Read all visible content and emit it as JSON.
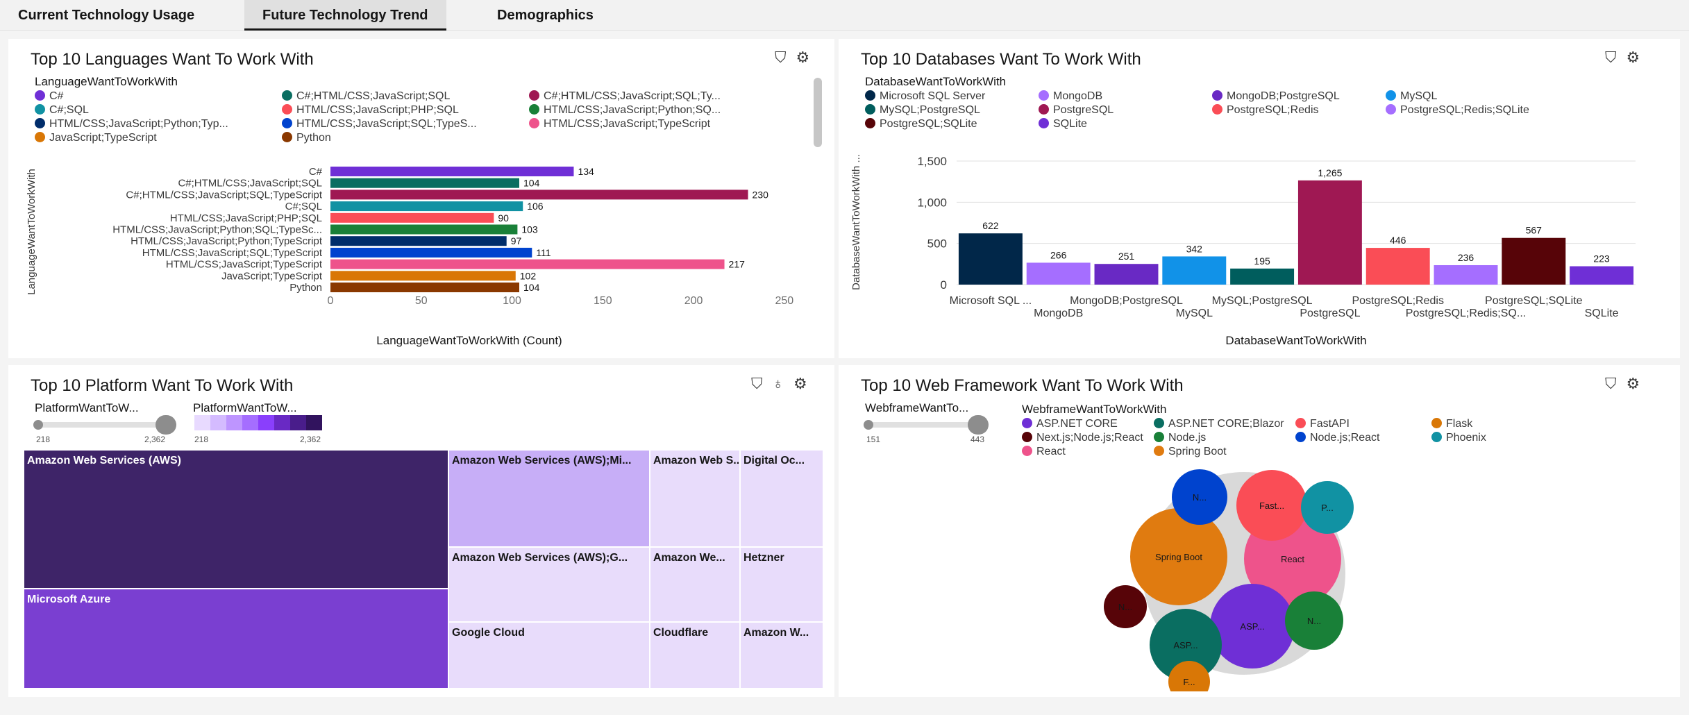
{
  "tabs": [
    {
      "label": "Current Technology Usage",
      "active": false
    },
    {
      "label": "Future Technology Trend",
      "active": true
    },
    {
      "label": "Demographics",
      "active": false
    }
  ],
  "lang": {
    "title": "Top 10 Languages Want To Work With",
    "legend_title": "LanguageWantToWorkWith",
    "legend": [
      {
        "label": "C#",
        "color": "#6f2fd6"
      },
      {
        "label": "C#;HTML/CSS;JavaScript;SQL",
        "color": "#0a6e61"
      },
      {
        "label": "C#;HTML/CSS;JavaScript;SQL;Ty...",
        "color": "#9f1853"
      },
      {
        "label": "C#;SQL",
        "color": "#1192a3"
      },
      {
        "label": "HTML/CSS;JavaScript;PHP;SQL",
        "color": "#fa4d56"
      },
      {
        "label": "HTML/CSS;JavaScript;Python;SQ...",
        "color": "#198038"
      },
      {
        "label": "HTML/CSS;JavaScript;Python;Typ...",
        "color": "#002d6b"
      },
      {
        "label": "HTML/CSS;JavaScript;SQL;TypeS...",
        "color": "#0043ce"
      },
      {
        "label": "HTML/CSS;JavaScript;TypeScript",
        "color": "#ee538b"
      },
      {
        "label": "JavaScript;TypeScript",
        "color": "#d97706"
      },
      {
        "label": "Python",
        "color": "#8a3800"
      }
    ],
    "ylabel": "LanguageWantToWorkWith",
    "xlabel": "LanguageWantToWorkWith (Count)"
  },
  "db": {
    "title": "Top 10 Databases Want To Work With",
    "legend_title": "DatabaseWantToWorkWith",
    "legend": [
      {
        "label": "Microsoft SQL Server",
        "color": "#012749"
      },
      {
        "label": "MongoDB",
        "color": "#a56eff"
      },
      {
        "label": "MongoDB;PostgreSQL",
        "color": "#6929c4"
      },
      {
        "label": "MySQL",
        "color": "#1192e8"
      },
      {
        "label": "MySQL;PostgreSQL",
        "color": "#005d5d"
      },
      {
        "label": "PostgreSQL",
        "color": "#9f1853"
      },
      {
        "label": "PostgreSQL;Redis",
        "color": "#fa4d56"
      },
      {
        "label": "PostgreSQL;Redis;SQLite",
        "color": "#a56eff"
      },
      {
        "label": "PostgreSQL;SQLite",
        "color": "#570408"
      },
      {
        "label": "SQLite",
        "color": "#6f2fd6"
      }
    ],
    "ylabel": "DatabaseWantToWorkWith ...",
    "xlabel": "DatabaseWantToWorkWith"
  },
  "platform": {
    "title": "Top 10 Platform Want To Work With",
    "slider1_title": "PlatformWantToW...",
    "slider2_title": "PlatformWantToW...",
    "min": "218",
    "max": "2,362",
    "scale_colors": [
      "#e8daff",
      "#d4bbff",
      "#be95ff",
      "#a56eff",
      "#8a3ffc",
      "#6929c4",
      "#491d8b",
      "#31135e"
    ],
    "cells": [
      {
        "label": "Amazon Web Services (AWS)",
        "bg": "#3e2468",
        "fg": "#ffffff"
      },
      {
        "label": "Microsoft Azure",
        "bg": "#7a3fd1",
        "fg": "#ffffff"
      },
      {
        "label": "Amazon Web Services (AWS);Mi...",
        "bg": "#c7aef7",
        "fg": "#161616"
      },
      {
        "label": "Amazon Web Services (AWS);G...",
        "bg": "#e8dcfb",
        "fg": "#161616"
      },
      {
        "label": "Google Cloud",
        "bg": "#e8dcfb",
        "fg": "#161616"
      },
      {
        "label": "Amazon Web S...",
        "bg": "#e8dcfb",
        "fg": "#161616"
      },
      {
        "label": "Digital Oc...",
        "bg": "#e8dcfb",
        "fg": "#161616"
      },
      {
        "label": "Amazon We...",
        "bg": "#e8dcfb",
        "fg": "#161616"
      },
      {
        "label": "Hetzner",
        "bg": "#e8dcfb",
        "fg": "#161616"
      },
      {
        "label": "Cloudflare",
        "bg": "#e8dcfb",
        "fg": "#161616"
      },
      {
        "label": "Amazon W...",
        "bg": "#e8dcfb",
        "fg": "#161616"
      }
    ]
  },
  "web": {
    "title": "Top 10 Web Framework Want To Work With",
    "slider_title": "WebframeWantTo...",
    "min": "151",
    "max": "443",
    "legend_title": "WebframeWantToWorkWith",
    "legend": [
      {
        "label": "ASP.NET CORE",
        "color": "#6f2fd6"
      },
      {
        "label": "ASP.NET CORE;Blazor",
        "color": "#0a6e61"
      },
      {
        "label": "FastAPI",
        "color": "#fa4d56"
      },
      {
        "label": "Flask",
        "color": "#d97706"
      },
      {
        "label": "Next.js;Node.js;React",
        "color": "#570408"
      },
      {
        "label": "Node.js",
        "color": "#198038"
      },
      {
        "label": "Node.js;React",
        "color": "#0043ce"
      },
      {
        "label": "Phoenix",
        "color": "#1192a3"
      },
      {
        "label": "React",
        "color": "#ee538b"
      },
      {
        "label": "Spring Boot",
        "color": "#e07b10"
      }
    ],
    "bubbles": [
      {
        "label": "Spring Boot",
        "color": "#e07b10"
      },
      {
        "label": "React",
        "color": "#ee538b"
      },
      {
        "label": "Fast...",
        "color": "#fa4d56"
      },
      {
        "label": "N...",
        "color": "#0043ce"
      },
      {
        "label": "P...",
        "color": "#1192a3"
      },
      {
        "label": "ASP...",
        "color": "#6f2fd6"
      },
      {
        "label": "ASP...",
        "color": "#0a6e61"
      },
      {
        "label": "N...",
        "color": "#198038"
      },
      {
        "label": "N...",
        "color": "#570408"
      },
      {
        "label": "F...",
        "color": "#d97706"
      }
    ]
  },
  "chart_data": [
    {
      "type": "bar",
      "orientation": "horizontal",
      "title": "Top 10 Languages Want To Work With",
      "xlabel": "LanguageWantToWorkWith (Count)",
      "ylabel": "LanguageWantToWorkWith",
      "categories": [
        "C#",
        "C#;HTML/CSS;JavaScript;SQL",
        "C#;HTML/CSS;JavaScript;SQL;TypeScript",
        "C#;SQL",
        "HTML/CSS;JavaScript;PHP;SQL",
        "HTML/CSS;JavaScript;Python;SQL;TypeSc...",
        "HTML/CSS;JavaScript;Python;TypeScript",
        "HTML/CSS;JavaScript;SQL;TypeScript",
        "HTML/CSS;JavaScript;TypeScript",
        "JavaScript;TypeScript",
        "Python"
      ],
      "values": [
        134,
        104,
        230,
        106,
        90,
        103,
        97,
        111,
        217,
        102,
        104
      ],
      "colors": [
        "#6f2fd6",
        "#0a6e61",
        "#9f1853",
        "#1192a3",
        "#fa4d56",
        "#198038",
        "#002d6b",
        "#0043ce",
        "#ee538b",
        "#d97706",
        "#8a3800"
      ],
      "xticks": [
        "0",
        "50",
        "100",
        "150",
        "200",
        "250"
      ],
      "xlim": [
        0,
        260
      ]
    },
    {
      "type": "bar",
      "title": "Top 10 Databases Want To Work With",
      "xlabel": "DatabaseWantToWorkWith",
      "ylabel": "DatabaseWantToWorkWith ...",
      "categories": [
        "Microsoft SQL ...",
        "MongoDB",
        "MongoDB;PostgreSQL",
        "MySQL",
        "MySQL;PostgreSQL",
        "PostgreSQL",
        "PostgreSQL;Redis",
        "PostgreSQL;Redis;SQ...",
        "PostgreSQL;SQLite",
        "SQLite"
      ],
      "values": [
        622,
        266,
        251,
        342,
        195,
        1265,
        446,
        236,
        567,
        223
      ],
      "value_labels": [
        "622",
        "266",
        "251",
        "342",
        "195",
        "1,265",
        "446",
        "236",
        "567",
        "223"
      ],
      "colors": [
        "#012749",
        "#a56eff",
        "#6929c4",
        "#1192e8",
        "#005d5d",
        "#9f1853",
        "#fa4d56",
        "#a56eff",
        "#570408",
        "#6f2fd6"
      ],
      "yticks": [
        "0",
        "500",
        "1,000",
        "1,500"
      ],
      "ylim": [
        0,
        1500
      ]
    }
  ]
}
